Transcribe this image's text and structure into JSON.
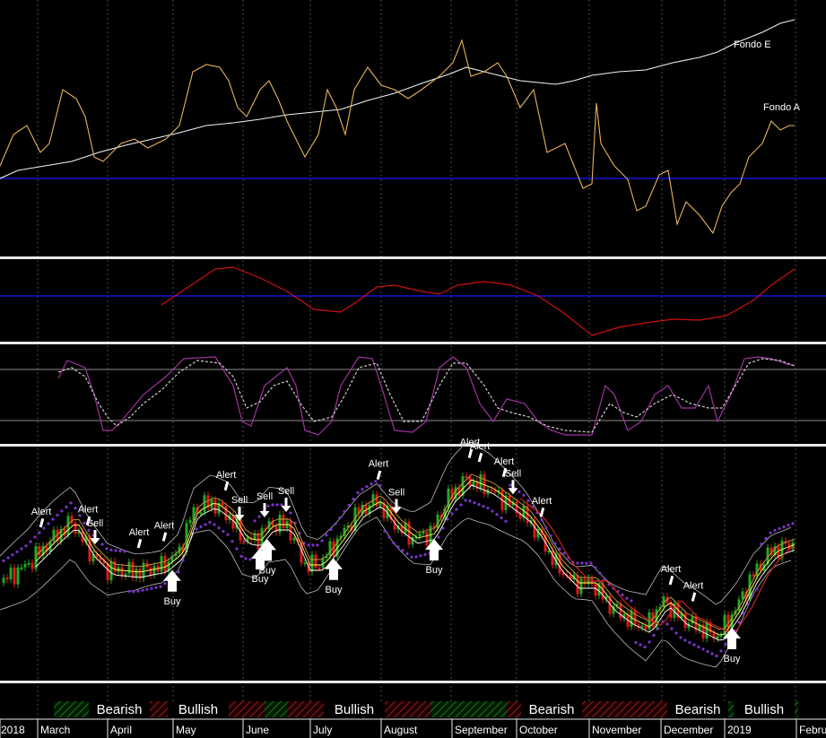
{
  "chart_data": [
    {
      "type": "line",
      "panel": "comparison",
      "y_scale": "unlabeled",
      "series": [
        {
          "name": "Fondo E",
          "color": "#f2f2f2",
          "points": [
            [
              0,
              199
            ],
            [
              20,
              190
            ],
            [
              50,
              185
            ],
            [
              80,
              180
            ],
            [
              110,
              170
            ],
            [
              140,
              162
            ],
            [
              170,
              155
            ],
            [
              200,
              148
            ],
            [
              230,
              140
            ],
            [
              260,
              137
            ],
            [
              290,
              133
            ],
            [
              320,
              128
            ],
            [
              350,
              125
            ],
            [
              380,
              122
            ],
            [
              410,
              112
            ],
            [
              440,
              104
            ],
            [
              470,
              93
            ],
            [
              500,
              83
            ],
            [
              520,
              75
            ],
            [
              540,
              80
            ],
            [
              560,
              85
            ],
            [
              580,
              90
            ],
            [
              600,
              92
            ],
            [
              620,
              94
            ],
            [
              640,
              90
            ],
            [
              660,
              84
            ],
            [
              690,
              80
            ],
            [
              720,
              78
            ],
            [
              750,
              70
            ],
            [
              780,
              64
            ],
            [
              800,
              58
            ],
            [
              820,
              48
            ],
            [
              850,
              36
            ],
            [
              870,
              26
            ],
            [
              886,
              22
            ]
          ]
        },
        {
          "name": "Fondo A",
          "color": "#e8b45a",
          "points": [
            [
              0,
              185
            ],
            [
              15,
              150
            ],
            [
              30,
              140
            ],
            [
              45,
              170
            ],
            [
              55,
              160
            ],
            [
              70,
              100
            ],
            [
              85,
              110
            ],
            [
              95,
              130
            ],
            [
              105,
              175
            ],
            [
              115,
              180
            ],
            [
              135,
              160
            ],
            [
              150,
              155
            ],
            [
              165,
              165
            ],
            [
              175,
              160
            ],
            [
              185,
              155
            ],
            [
              200,
              140
            ],
            [
              215,
              80
            ],
            [
              230,
              72
            ],
            [
              245,
              75
            ],
            [
              255,
              90
            ],
            [
              265,
              120
            ],
            [
              275,
              130
            ],
            [
              290,
              100
            ],
            [
              300,
              90
            ],
            [
              310,
              110
            ],
            [
              320,
              135
            ],
            [
              340,
              175
            ],
            [
              355,
              150
            ],
            [
              365,
              100
            ],
            [
              375,
              120
            ],
            [
              385,
              150
            ],
            [
              395,
              100
            ],
            [
              410,
              75
            ],
            [
              425,
              95
            ],
            [
              440,
              100
            ],
            [
              455,
              110
            ],
            [
              470,
              100
            ],
            [
              490,
              85
            ],
            [
              505,
              70
            ],
            [
              515,
              45
            ],
            [
              525,
              85
            ],
            [
              540,
              80
            ],
            [
              555,
              70
            ],
            [
              565,
              85
            ],
            [
              580,
              120
            ],
            [
              595,
              100
            ],
            [
              610,
              170
            ],
            [
              630,
              160
            ],
            [
              650,
              210
            ],
            [
              660,
              205
            ],
            [
              665,
              115
            ],
            [
              670,
              160
            ],
            [
              685,
              185
            ],
            [
              700,
              200
            ],
            [
              710,
              235
            ],
            [
              720,
              230
            ],
            [
              735,
              195
            ],
            [
              745,
              190
            ],
            [
              755,
              250
            ],
            [
              765,
              225
            ],
            [
              780,
              240
            ],
            [
              795,
              260
            ],
            [
              805,
              230
            ],
            [
              815,
              215
            ],
            [
              825,
              205
            ],
            [
              835,
              175
            ],
            [
              850,
              160
            ],
            [
              860,
              135
            ],
            [
              870,
              145
            ],
            [
              880,
              140
            ],
            [
              886,
              140
            ]
          ]
        }
      ]
    },
    {
      "type": "line",
      "panel": "indicator-1",
      "y_scale": "unlabeled",
      "series": [
        {
          "name": "",
          "color": "#cc1111",
          "points": [
            [
              180,
              340
            ],
            [
              210,
              320
            ],
            [
              240,
              300
            ],
            [
              260,
              298
            ],
            [
              290,
              310
            ],
            [
              320,
              325
            ],
            [
              350,
              345
            ],
            [
              380,
              348
            ],
            [
              400,
              335
            ],
            [
              420,
              320
            ],
            [
              440,
              318
            ],
            [
              470,
              325
            ],
            [
              490,
              328
            ],
            [
              510,
              318
            ],
            [
              540,
              314
            ],
            [
              570,
              318
            ],
            [
              600,
              330
            ],
            [
              630,
              350
            ],
            [
              660,
              374
            ],
            [
              690,
              365
            ],
            [
              720,
              360
            ],
            [
              750,
              356
            ],
            [
              780,
              357
            ],
            [
              810,
              352
            ],
            [
              840,
              335
            ],
            [
              860,
              318
            ],
            [
              886,
              300
            ]
          ]
        }
      ]
    },
    {
      "type": "line",
      "panel": "oscillator",
      "y_scale": "unlabeled",
      "series": [
        {
          "name": "",
          "color": "#a033a0",
          "points": [
            [
              65,
              422
            ],
            [
              75,
              402
            ],
            [
              95,
              410
            ],
            [
              105,
              440
            ],
            [
              115,
              480
            ],
            [
              125,
              480
            ],
            [
              135,
              470
            ],
            [
              160,
              440
            ],
            [
              185,
              420
            ],
            [
              205,
              400
            ],
            [
              240,
              398
            ],
            [
              260,
              430
            ],
            [
              270,
              470
            ],
            [
              280,
              475
            ],
            [
              295,
              430
            ],
            [
              320,
              410
            ],
            [
              330,
              430
            ],
            [
              340,
              480
            ],
            [
              355,
              485
            ],
            [
              370,
              470
            ],
            [
              380,
              430
            ],
            [
              400,
              398
            ],
            [
              415,
              400
            ],
            [
              425,
              430
            ],
            [
              440,
              480
            ],
            [
              460,
              482
            ],
            [
              475,
              470
            ],
            [
              490,
              410
            ],
            [
              505,
              398
            ],
            [
              520,
              410
            ],
            [
              535,
              450
            ],
            [
              550,
              470
            ],
            [
              565,
              445
            ],
            [
              585,
              450
            ],
            [
              600,
              470
            ],
            [
              615,
              480
            ],
            [
              630,
              485
            ],
            [
              660,
              485
            ],
            [
              675,
              430
            ],
            [
              685,
              440
            ],
            [
              700,
              480
            ],
            [
              715,
              470
            ],
            [
              730,
              440
            ],
            [
              745,
              430
            ],
            [
              760,
              455
            ],
            [
              775,
              455
            ],
            [
              790,
              430
            ],
            [
              800,
              470
            ],
            [
              815,
              440
            ],
            [
              830,
              400
            ],
            [
              845,
              398
            ],
            [
              860,
              400
            ],
            [
              875,
              405
            ],
            [
              886,
              408
            ]
          ]
        },
        {
          "name": "",
          "color": "#cccccc",
          "points": [
            [
              65,
              415
            ],
            [
              80,
              410
            ],
            [
              95,
              420
            ],
            [
              110,
              450
            ],
            [
              120,
              465
            ],
            [
              130,
              475
            ],
            [
              145,
              465
            ],
            [
              160,
              450
            ],
            [
              180,
              435
            ],
            [
              200,
              415
            ],
            [
              220,
              402
            ],
            [
              245,
              405
            ],
            [
              260,
              420
            ],
            [
              275,
              455
            ],
            [
              290,
              448
            ],
            [
              305,
              430
            ],
            [
              320,
              425
            ],
            [
              335,
              450
            ],
            [
              350,
              470
            ],
            [
              370,
              465
            ],
            [
              385,
              440
            ],
            [
              400,
              410
            ],
            [
              420,
              405
            ],
            [
              435,
              440
            ],
            [
              450,
              470
            ],
            [
              470,
              470
            ],
            [
              490,
              430
            ],
            [
              505,
              405
            ],
            [
              520,
              405
            ],
            [
              540,
              430
            ],
            [
              555,
              455
            ],
            [
              570,
              460
            ],
            [
              590,
              465
            ],
            [
              610,
              475
            ],
            [
              630,
              480
            ],
            [
              660,
              482
            ],
            [
              680,
              450
            ],
            [
              695,
              460
            ],
            [
              710,
              465
            ],
            [
              730,
              450
            ],
            [
              750,
              440
            ],
            [
              770,
              450
            ],
            [
              790,
              455
            ],
            [
              805,
              455
            ],
            [
              820,
              430
            ],
            [
              835,
              405
            ],
            [
              850,
              400
            ],
            [
              870,
              402
            ],
            [
              886,
              408
            ]
          ]
        }
      ]
    }
  ],
  "price_panel": {
    "type": "candlestick",
    "signals": [
      {
        "label": "Alert",
        "kind": "alert",
        "x": 46
      },
      {
        "label": "Alert",
        "kind": "alert",
        "x": 98
      },
      {
        "label": "Sell",
        "kind": "sell",
        "x": 106
      },
      {
        "label": "Alert",
        "kind": "alert",
        "x": 155
      },
      {
        "label": "Alert",
        "kind": "alert",
        "x": 183
      },
      {
        "label": "Buy",
        "kind": "buy",
        "x": 192
      },
      {
        "label": "Alert",
        "kind": "alert",
        "x": 252
      },
      {
        "label": "Sell",
        "kind": "sell",
        "x": 267
      },
      {
        "label": "Sell",
        "kind": "sell",
        "x": 295
      },
      {
        "label": "Buy",
        "kind": "buy",
        "x": 290
      },
      {
        "label": "Buy",
        "kind": "buy",
        "x": 298
      },
      {
        "label": "Sell",
        "kind": "sell",
        "x": 319
      },
      {
        "label": "Buy",
        "kind": "buy",
        "x": 372
      },
      {
        "label": "Alert",
        "kind": "alert",
        "x": 422
      },
      {
        "label": "Sell",
        "kind": "sell",
        "x": 442
      },
      {
        "label": "Buy",
        "kind": "buy",
        "x": 484
      },
      {
        "label": "Alert",
        "kind": "alert",
        "x": 524
      },
      {
        "label": "Alert",
        "kind": "alert",
        "x": 535
      },
      {
        "label": "Alert",
        "kind": "alert",
        "x": 562
      },
      {
        "label": "Sell",
        "kind": "sell",
        "x": 572
      },
      {
        "label": "Alert",
        "kind": "alert",
        "x": 604
      },
      {
        "label": "Alert",
        "kind": "alert",
        "x": 748
      },
      {
        "label": "Alert",
        "kind": "alert",
        "x": 773
      },
      {
        "label": "Buy",
        "kind": "buy",
        "x": 816
      }
    ]
  },
  "regime_bar": {
    "labels": [
      "Bearish",
      "Bullish",
      "Bullish",
      "Bearish",
      "Bearish",
      "Bullish"
    ],
    "colors": {
      "bearish": "#8a1a1a",
      "bullish": "#1a6a1a"
    }
  },
  "x_axis": {
    "labels": [
      "2018",
      "March",
      "April",
      "May",
      "June",
      "July",
      "August",
      "September",
      "October",
      "November",
      "December",
      "2019",
      "Febru"
    ]
  }
}
